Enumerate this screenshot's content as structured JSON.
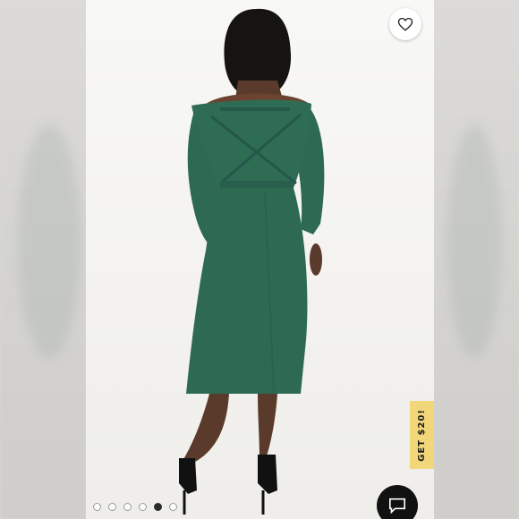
{
  "product_image": {
    "icon": "product-photo",
    "dress_color": "#2e6a52",
    "background_color": "#f5f4f1"
  },
  "like_button": {
    "icon": "heart-icon"
  },
  "promo_tab": {
    "label": "GET $20!",
    "color": "#f2d77a"
  },
  "chat_button": {
    "icon": "chat-bubble-icon",
    "color": "#111111"
  },
  "carousel": {
    "total": 6,
    "active_index": 4
  }
}
